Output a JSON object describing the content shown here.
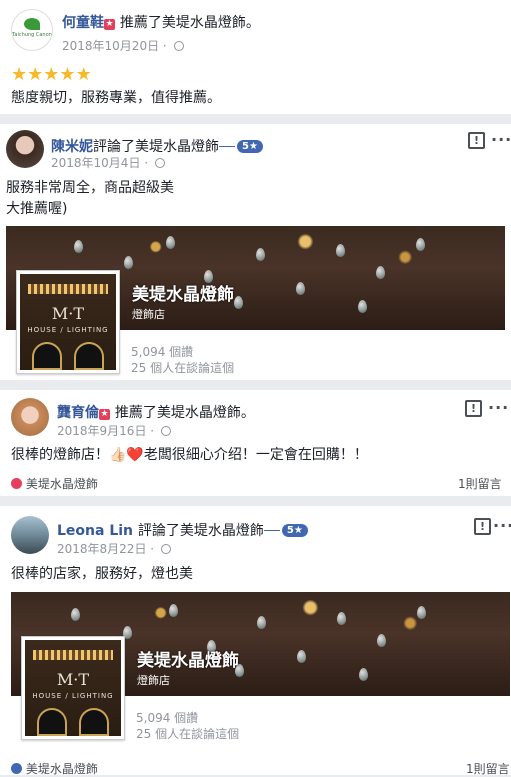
{
  "reviews": [
    {
      "name": "何童鞋",
      "action": "推薦了美堤水晶燈飾。",
      "date": "2018年10月20日",
      "stars": 5,
      "text": "態度親切，服務專業，值得推薦。",
      "avatar_text": "Taichung Canon"
    },
    {
      "name": "陳米妮",
      "action": "評論了美堤水晶燈飾",
      "badge": "5★",
      "date": "2018年10月4日",
      "text_lines": [
        "服務非常周全，商品超級美",
        "大推薦喔)"
      ],
      "page_title": "美堤水晶燈飾",
      "page_category": "燈飾店",
      "stats_views": "5,094 個讚",
      "stats_talking": "25 個人在談論這個"
    },
    {
      "name": "龔育倫",
      "action": "推薦了美堤水晶燈飾。",
      "date": "2018年9月16日",
      "text": "很棒的燈飾店！👍🏻❤️老闆很細心介绍！一定會在回購！！",
      "footer_left": "美堤水晶燈飾",
      "footer_right": "1則留言"
    },
    {
      "name": "Leona Lin",
      "action": "評論了美堤水晶燈飾",
      "badge": "5★",
      "date": "2018年8月22日",
      "text": "很棒的店家，服務好，燈也美",
      "page_title": "美堤水晶燈飾",
      "page_category": "燈飾店",
      "stats_views": "5,094 個讚",
      "stats_talking": "25 個人在談論這個",
      "footer_left": "美堤水晶燈飾",
      "footer_right": "1則留言"
    }
  ],
  "logo": {
    "mt": "M·T",
    "sub": "HOUSE / LIGHTING"
  },
  "icons": {
    "more": "···",
    "chat": "!"
  }
}
